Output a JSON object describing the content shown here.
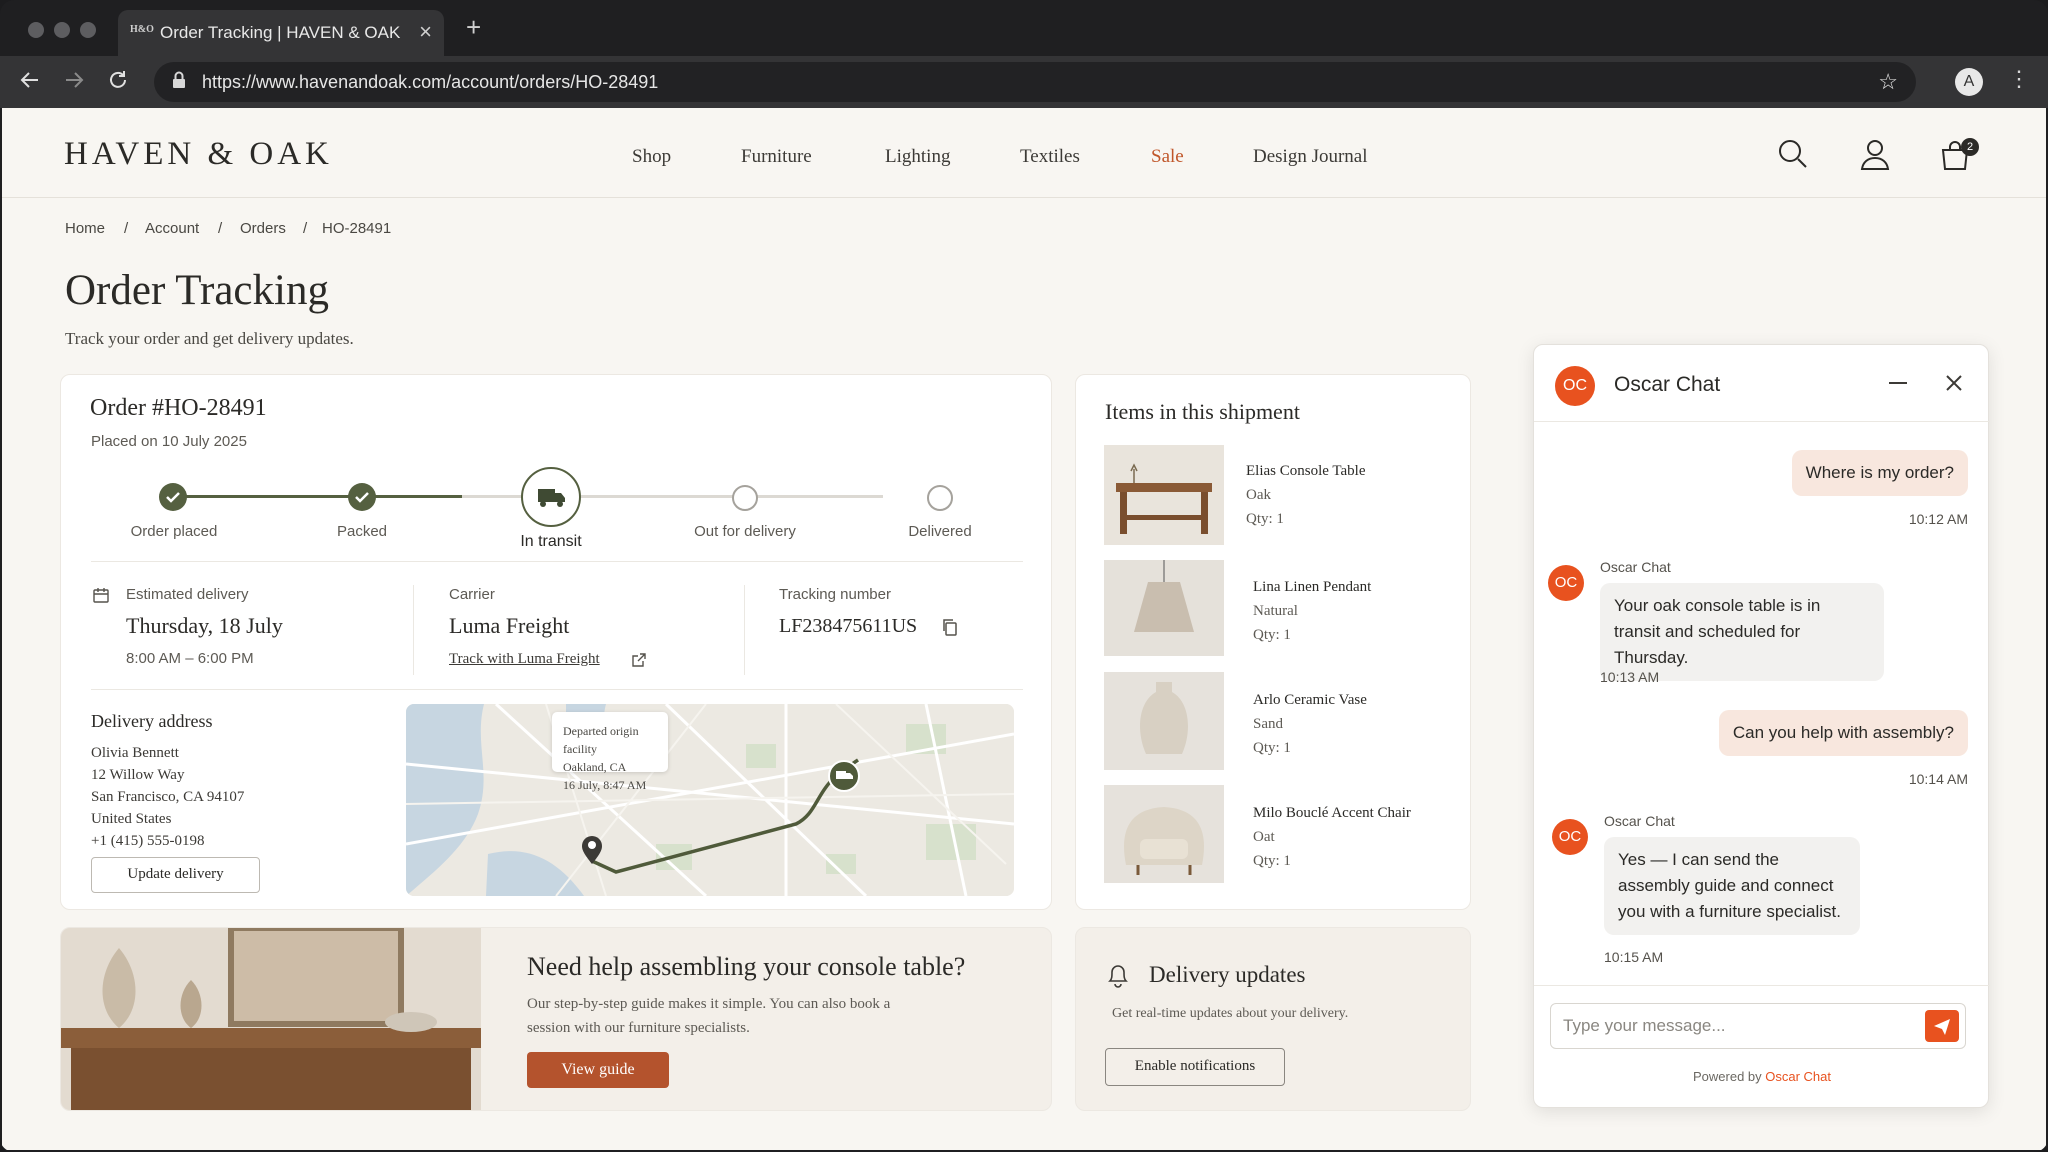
{
  "browser": {
    "tab_title": "Order Tracking | HAVEN & OAK",
    "tab_favicon": "H&O",
    "url": "https://www.havenandoak.com/account/orders/HO-28491",
    "profile_initial": "A"
  },
  "site": {
    "logo": "HAVEN & OAK",
    "nav": [
      "Shop",
      "Furniture",
      "Lighting",
      "Textiles",
      "Sale",
      "Design Journal"
    ],
    "sale_color": "#c0562a",
    "cart_count": "2"
  },
  "breadcrumb": [
    "Home",
    "Account",
    "Orders",
    "HO-28491"
  ],
  "page": {
    "title": "Order Tracking",
    "subtitle": "Track your order and get delivery updates."
  },
  "order": {
    "number": "Order #HO-28491",
    "placed": "Placed on 10 July 2025",
    "steps": [
      {
        "label": "Order placed",
        "state": "done"
      },
      {
        "label": "Packed",
        "state": "done"
      },
      {
        "label": "In transit",
        "state": "current"
      },
      {
        "label": "Out for delivery",
        "state": "pending"
      },
      {
        "label": "Delivered",
        "state": "pending"
      }
    ],
    "estimated_label": "Estimated delivery",
    "estimated_day": "Thursday, 18 July",
    "estimated_window": "8:00 AM – 6:00 PM",
    "carrier_label": "Carrier",
    "carrier": "Luma Freight",
    "carrier_link": "Track with Luma Freight",
    "tracking_label": "Tracking number",
    "tracking_number": "LF238475611US",
    "address_label": "Delivery address",
    "address": [
      "Olivia Bennett",
      "12 Willow Way",
      "San Francisco, CA 94107",
      "United States",
      "+1 (415) 555-0198"
    ],
    "update_button": "Update delivery",
    "map_popup": [
      "Departed origin facility",
      "Oakland, CA",
      "16 July, 8:47 AM"
    ]
  },
  "shipment": {
    "title": "Items in this shipment",
    "items": [
      {
        "name": "Elias Console Table",
        "variant": "Oak",
        "qty": "Qty: 1",
        "icon": "console-table"
      },
      {
        "name": "Lina Linen Pendant",
        "variant": "Natural",
        "qty": "Qty: 1",
        "icon": "pendant-lamp"
      },
      {
        "name": "Arlo Ceramic Vase",
        "variant": "Sand",
        "qty": "Qty: 1",
        "icon": "vase"
      },
      {
        "name": "Milo Bouclé Accent Chair",
        "variant": "Oat",
        "qty": "Qty: 1",
        "icon": "armchair"
      }
    ]
  },
  "promo": {
    "title": "Need help assembling your console table?",
    "body": "Our step-by-step guide makes it simple. You can also book a session with our furniture specialists.",
    "button": "View guide"
  },
  "updates": {
    "title": "Delivery updates",
    "body": "Get real-time updates about your delivery.",
    "button": "Enable notifications"
  },
  "chat": {
    "avatar": "OC",
    "title": "Oscar Chat",
    "messages": [
      {
        "from": "user",
        "text": "Where is my order?",
        "time": "10:12 AM"
      },
      {
        "from": "bot",
        "sender": "Oscar Chat",
        "text": "Your oak console table is in transit and scheduled for Thursday.",
        "time": "10:13 AM"
      },
      {
        "from": "user",
        "text": "Can you help with assembly?",
        "time": "10:14 AM"
      },
      {
        "from": "bot",
        "sender": "Oscar Chat",
        "text": "Yes — I can send the assembly guide and connect you with a furniture specialist.",
        "time": "10:15 AM"
      }
    ],
    "input_placeholder": "Type your message...",
    "powered_prefix": "Powered by",
    "powered_brand": "Oscar Chat",
    "accent": "#e8521f"
  },
  "colors": {
    "accent_green": "#556040",
    "promo_button": "#b4532d"
  }
}
